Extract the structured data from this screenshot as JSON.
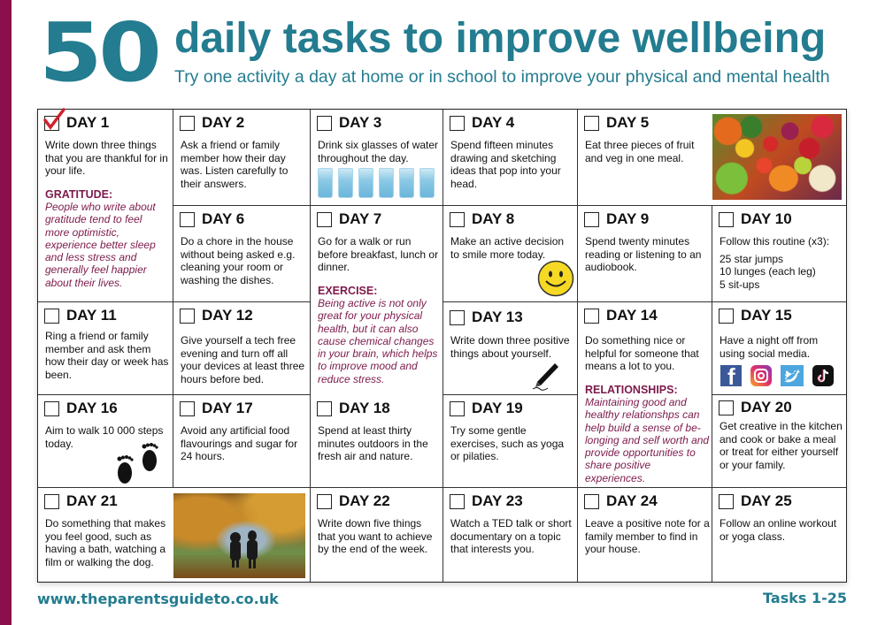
{
  "header": {
    "number": "50",
    "title": "daily tasks to improve wellbeing",
    "subtitle": "Try one activity a day at home or in school to improve your physical and mental health"
  },
  "colors": {
    "brand_teal": "#237c8f",
    "accent_maroon": "#8a0f4a",
    "note_maroon": "#7c1a4b",
    "check_red": "#d0202e"
  },
  "days": [
    {
      "label": "DAY 1",
      "text": "Write down three things that you are thankful for in your life.",
      "checked": true,
      "category": "GRATITUDE:",
      "note": "People who write about gratitude tend to feel more optimistic, experience better sleep and less stress and generally feel happier about their lives."
    },
    {
      "label": "DAY 2",
      "text": "Ask a friend or family member how their day was. Listen carefully to their answers.",
      "checked": false
    },
    {
      "label": "DAY 3",
      "text": "Drink six glasses of water throughout the day.",
      "checked": false,
      "icon": "water-glasses"
    },
    {
      "label": "DAY 4",
      "text": "Spend fifteen minutes drawing and sketching ideas that pop into your head.",
      "checked": false
    },
    {
      "label": "DAY 5",
      "text": "Eat three pieces of fruit and veg in one meal.",
      "checked": false,
      "icon": "fruit-veg-photo"
    },
    {
      "label": "DAY 6",
      "text": "Do a chore in the house without being asked e.g. cleaning your room or washing the dishes.",
      "checked": false
    },
    {
      "label": "DAY 7",
      "text": "Go for a walk or run before breakfast, lunch or dinner.",
      "checked": false,
      "category": "EXERCISE:",
      "note": "Being active is not only great for your physical health, but it can also cause chemical changes in your brain, which helps to improve mood and reduce stress."
    },
    {
      "label": "DAY 8",
      "text": "Make an active decision to smile more today.",
      "checked": false,
      "icon": "smiley-face"
    },
    {
      "label": "DAY 9",
      "text": "Spend twenty minutes reading or listening to an audiobook.",
      "checked": false
    },
    {
      "label": "DAY 10",
      "text": "Follow this routine (x3):",
      "checked": false,
      "routine": [
        "25 star jumps",
        "10 lunges (each leg)",
        "5 sit-ups"
      ]
    },
    {
      "label": "DAY 11",
      "text": "Ring a friend or family member and ask them how their day or week has been.",
      "checked": false
    },
    {
      "label": "DAY 12",
      "text": "Give yourself a tech free evening and turn off all your devices at least three hours before bed.",
      "checked": false
    },
    {
      "label": "DAY 13",
      "text": "Write down three positive things about yourself.",
      "checked": false,
      "icon": "pen"
    },
    {
      "label": "DAY 14",
      "text": "Do something nice or helpful for someone that means a lot to you.",
      "checked": false,
      "category": "RELATIONSHIPS:",
      "note": "Maintaining good and healthy relationshps can help build a sense of be-longing and self worth and provide opportunities to share positive experiences."
    },
    {
      "label": "DAY 15",
      "text": "Have a night off from using social media.",
      "checked": false,
      "icons": [
        "facebook",
        "instagram",
        "twitter",
        "tiktok"
      ]
    },
    {
      "label": "DAY 16",
      "text": "Aim to walk 10 000 steps today.",
      "checked": false,
      "icon": "footprints"
    },
    {
      "label": "DAY 17",
      "text": "Avoid any artificial food flavourings and sugar for 24 hours.",
      "checked": false
    },
    {
      "label": "DAY 18",
      "text": "Spend at least thirty minutes outdoors in the fresh air and nature.",
      "checked": false
    },
    {
      "label": "DAY 19",
      "text": "Try some gentle exercises, such as yoga or pilaties.",
      "checked": false
    },
    {
      "label": "DAY 20",
      "text": "Get creative in the kitchen and cook or bake a meal or treat for either yourself or your family.",
      "checked": false
    },
    {
      "label": "DAY 21",
      "text": "Do something that makes you feel good, such as having a bath, watching a film or walking the dog.",
      "checked": false,
      "icon": "autumn-walk-photo"
    },
    {
      "label": "DAY 22",
      "text": "Write down five things that you want to achieve by the end of the week.",
      "checked": false
    },
    {
      "label": "DAY 23",
      "text": "Watch a TED talk or short documentary on a topic that interests you.",
      "checked": false
    },
    {
      "label": "DAY 24",
      "text": "Leave a positive note for a family member to find in your house.",
      "checked": false
    },
    {
      "label": "DAY 25",
      "text": "Follow an online workout or yoga class.",
      "checked": false
    }
  ],
  "footer": {
    "url": "www.theparentsguideto.co.uk",
    "tasks": "Tasks 1-25"
  }
}
